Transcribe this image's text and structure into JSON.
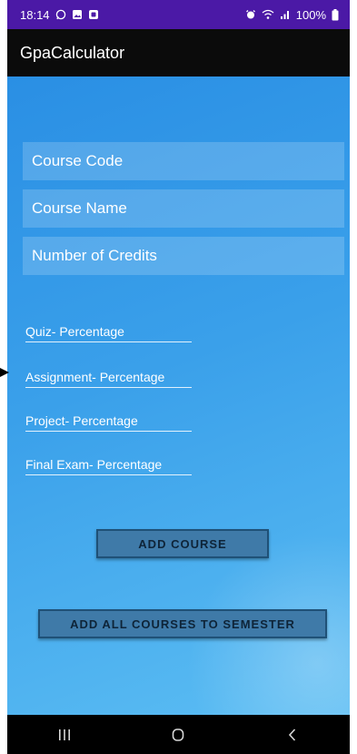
{
  "status_bar": {
    "time": "18:14",
    "battery": "100%",
    "left_icons": [
      "whatsapp-icon",
      "gallery-icon",
      "app-icon"
    ],
    "right_icons": [
      "alarm-icon",
      "wifi-icon",
      "signal-icon",
      "battery-icon"
    ]
  },
  "app_bar": {
    "title": "GpaCalculator"
  },
  "form": {
    "course_code_placeholder": "Course Code",
    "course_name_placeholder": "Course Name",
    "credits_placeholder": "Number of Credits",
    "quiz_label": "Quiz- Percentage",
    "assignment_label": "Assignment- Percentage",
    "project_label": "Project- Percentage",
    "final_label": "Final Exam- Percentage"
  },
  "buttons": {
    "add_course": "ADD COURSE",
    "add_all": "ADD ALL COURSES TO SEMESTER"
  },
  "nav_bar": {
    "icons": [
      "recent-apps-icon",
      "home-icon",
      "back-icon"
    ]
  },
  "colors": {
    "status_bar": "#4b19a6",
    "app_bar": "#0b0b0b",
    "background_start": "#2a8fe4",
    "background_end": "#5bbdf3",
    "button": "#3f7aa8"
  }
}
